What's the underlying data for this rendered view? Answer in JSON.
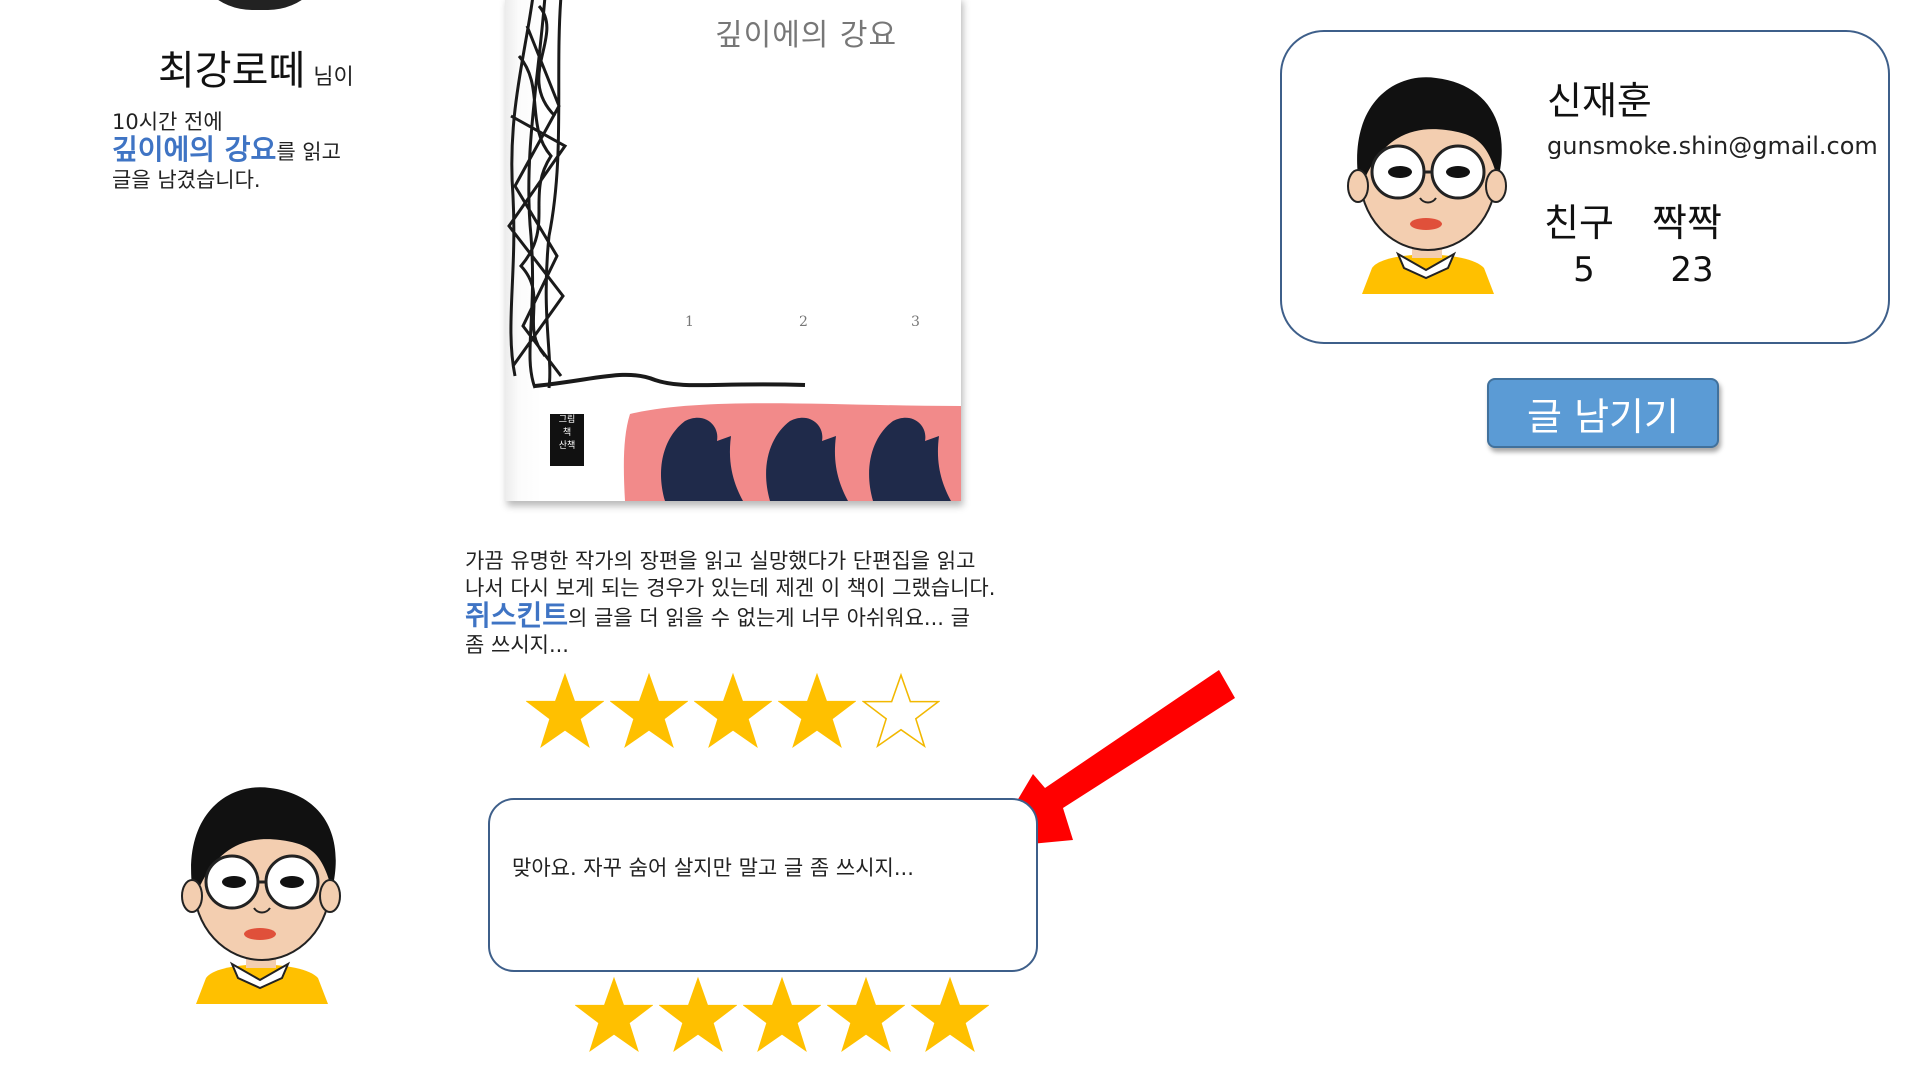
{
  "activity": {
    "nickname": "최강로떼",
    "honorific": "님이",
    "time_ago": "10시간 전에",
    "book_title": "깊이에의 강요",
    "action_suffix": "를 읽고",
    "action_line2": "글을 남겼습니다."
  },
  "book_cover": {
    "title": "깊이에의 강요",
    "numbers": [
      "1",
      "2",
      "3"
    ],
    "publisher": [
      "그림",
      "책",
      "산책"
    ]
  },
  "review": {
    "line1": "가끔 유명한 작가의 장편을 읽고 실망했다가 단편집을 읽고",
    "line2": "나서 다시 보게 되는 경우가 있는데 제겐 이 책이 그랬습니다.",
    "author": "쥐스킨트",
    "line3_suffix": "의 글을 더 읽을 수 없는게 너무 아쉬워요... 글",
    "line4": "좀 쓰시지...",
    "rating": 4,
    "max_rating": 5
  },
  "profile": {
    "name": "신재훈",
    "email": "gunsmoke.shin@gmail.com",
    "friends_label": "친구",
    "friends_count": "5",
    "pairs_label": "짝짝",
    "pairs_count": "23"
  },
  "write_button": {
    "label": "글 남기기"
  },
  "comment": {
    "text": "맞아요. 자꾸 숨어 살지만 말고 글 좀 쓰시지...",
    "rating": 5,
    "max_rating": 5
  },
  "colors": {
    "link": "#3f74c4",
    "star_fill": "#ffc000",
    "star_outline": "#f2b800",
    "button": "#5b9bd5",
    "card_border": "#3e5f8a",
    "arrow": "#ff0000"
  }
}
